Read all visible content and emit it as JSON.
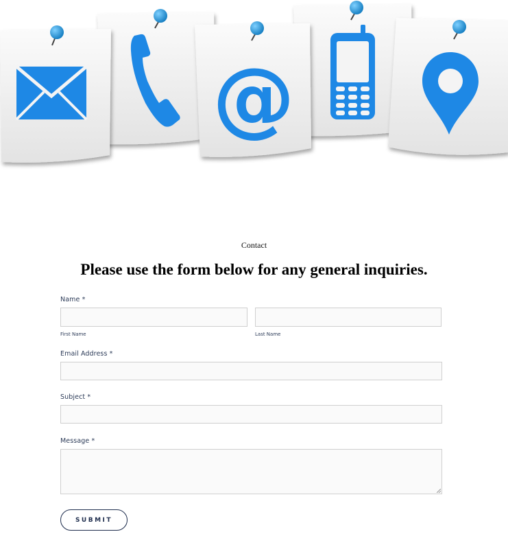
{
  "hero": {
    "icons": [
      "envelope-icon",
      "phone-icon",
      "at-sign-icon",
      "mobile-phone-icon",
      "location-pin-icon"
    ],
    "at_symbol": "@",
    "colors": {
      "icon_blue": "#1e88e5",
      "pin_blue": "#1a8fd6",
      "note_white": "#f4f4f4"
    }
  },
  "page": {
    "breadcrumb": "Contact",
    "headline": "Please use the form below for any general inquiries."
  },
  "form": {
    "name_label": "Name",
    "required_mark": "*",
    "first_name_label": "First Name",
    "last_name_label": "Last Name",
    "first_name_value": "",
    "last_name_value": "",
    "email_label": "Email Address",
    "email_value": "",
    "subject_label": "Subject",
    "subject_value": "",
    "message_label": "Message",
    "message_value": "",
    "submit_label": "SUBMIT"
  },
  "colors": {
    "label_text": "#2b3a57",
    "button_border": "#1e2d4d",
    "input_bg": "#fafafa",
    "input_border": "#cfcfcf"
  }
}
